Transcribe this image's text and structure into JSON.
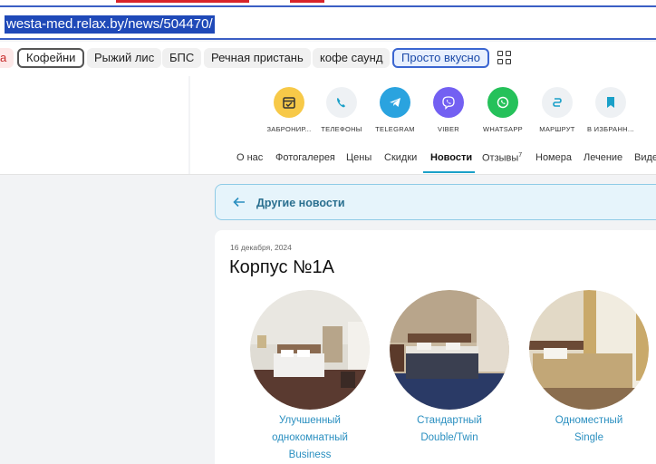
{
  "browser": {
    "url": "westa-med.relax.by/news/504470/"
  },
  "chips": {
    "items": [
      {
        "label": "а",
        "style": "edge"
      },
      {
        "label": "Кофейни",
        "style": "outlined"
      },
      {
        "label": "Рыжий лис",
        "style": "plain"
      },
      {
        "label": "БПС",
        "style": "plain"
      },
      {
        "label": "Речная пристань",
        "style": "plain"
      },
      {
        "label": "кофе саунд",
        "style": "plain"
      },
      {
        "label": "Просто вкусно",
        "style": "active"
      }
    ],
    "grid_icon": "grid-icon"
  },
  "actions": [
    {
      "label": "ЗАБРОНИР...",
      "icon": "calendar-icon",
      "color": "#f7c948"
    },
    {
      "label": "ТЕЛЕФОНЫ",
      "icon": "phone-icon",
      "color": "#eef1f4"
    },
    {
      "label": "TELEGRAM",
      "icon": "telegram-icon",
      "color": "#2aa3df"
    },
    {
      "label": "VIBER",
      "icon": "viber-icon",
      "color": "#7360f2"
    },
    {
      "label": "WHATSAPP",
      "icon": "whatsapp-icon",
      "color": "#25c15a"
    },
    {
      "label": "МАРШРУТ",
      "icon": "route-icon",
      "color": "#eef1f4"
    },
    {
      "label": "В ИЗБРАНН...",
      "icon": "bookmark-icon",
      "color": "#eef1f4"
    }
  ],
  "tabs": [
    {
      "label": "О нас"
    },
    {
      "label": "Фотогалерея"
    },
    {
      "label": "Цены"
    },
    {
      "label": "Скидки"
    },
    {
      "label": "Новости",
      "active": true
    },
    {
      "label": "Отзывы",
      "sup": "7"
    },
    {
      "label": "Номера"
    },
    {
      "label": "Лечение"
    },
    {
      "label": "Виде"
    }
  ],
  "news_back": {
    "label": "Другие новости"
  },
  "article": {
    "date": "16 декабря, 2024",
    "title": "Корпус №1А",
    "rooms": [
      {
        "line1": "Улучшенный",
        "line2": "однокомнатный",
        "line3": "Business"
      },
      {
        "line1": "Стандартный",
        "line2": "Double/Twin",
        "line3": ""
      },
      {
        "line1": "Одноместный",
        "line2": "Single",
        "line3": ""
      }
    ]
  },
  "colors": {
    "accent": "#1aa0c8",
    "link": "#2a8fc0",
    "selection": "#1f49b8"
  }
}
